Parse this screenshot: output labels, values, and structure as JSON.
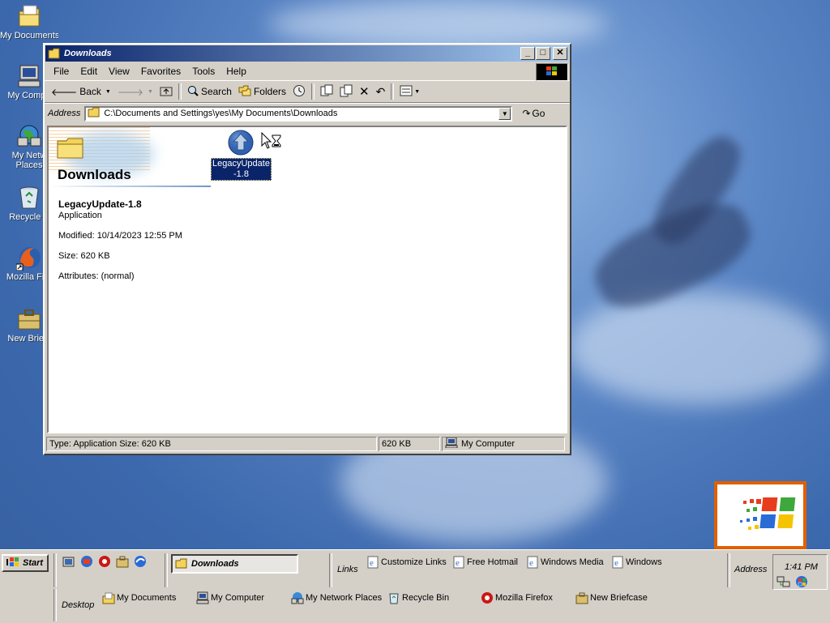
{
  "desktop": {
    "icons": [
      {
        "label": "My Documents",
        "icon": "my-documents-icon"
      },
      {
        "label": "My Compu",
        "icon": "my-computer-icon"
      },
      {
        "label": "My Netw",
        "label2": "Places",
        "icon": "network-places-icon"
      },
      {
        "label": "Recycle B",
        "icon": "recycle-bin-icon"
      },
      {
        "label": "Mozilla Fire",
        "icon": "firefox-icon"
      },
      {
        "label": "New Briefc",
        "icon": "briefcase-icon"
      }
    ]
  },
  "window": {
    "title": "Downloads",
    "menu": [
      "File",
      "Edit",
      "View",
      "Favorites",
      "Tools",
      "Help"
    ],
    "toolbar": {
      "back": "Back",
      "search": "Search",
      "folders": "Folders"
    },
    "address": {
      "label": "Address",
      "value": "C:\\Documents and Settings\\yes\\My Documents\\Downloads",
      "go": "Go"
    },
    "webview": {
      "folder_title": "Downloads",
      "item_name": "LegacyUpdate-1.8",
      "item_type": "Application",
      "modified": "Modified: 10/14/2023 12:55 PM",
      "size": "Size: 620 KB",
      "attributes": "Attributes: (normal)"
    },
    "file": {
      "label_line1": "LegacyUpdate",
      "label_line2": "-1.8",
      "icon": "legacy-update-icon"
    },
    "status": {
      "left": "Type: Application Size: 620 KB",
      "size": "620 KB",
      "zone": "My Computer"
    }
  },
  "taskbar": {
    "start": "Start",
    "task": "Downloads",
    "links_label": "Links",
    "links": [
      "Customize Links",
      "Free Hotmail",
      "Windows Media",
      "Windows"
    ],
    "address_label": "Address",
    "desktop_label": "Desktop",
    "desktop_items": [
      "My Documents",
      "My Computer",
      "My Network Places",
      "Recycle Bin",
      "Mozilla Firefox",
      "New Briefcase"
    ],
    "clock": "1:41 PM"
  },
  "colors": {
    "titlebar_start": "#0a246a",
    "titlebar_end": "#a6caf0",
    "face": "#d4d0c8",
    "selection": "#0a246a"
  }
}
